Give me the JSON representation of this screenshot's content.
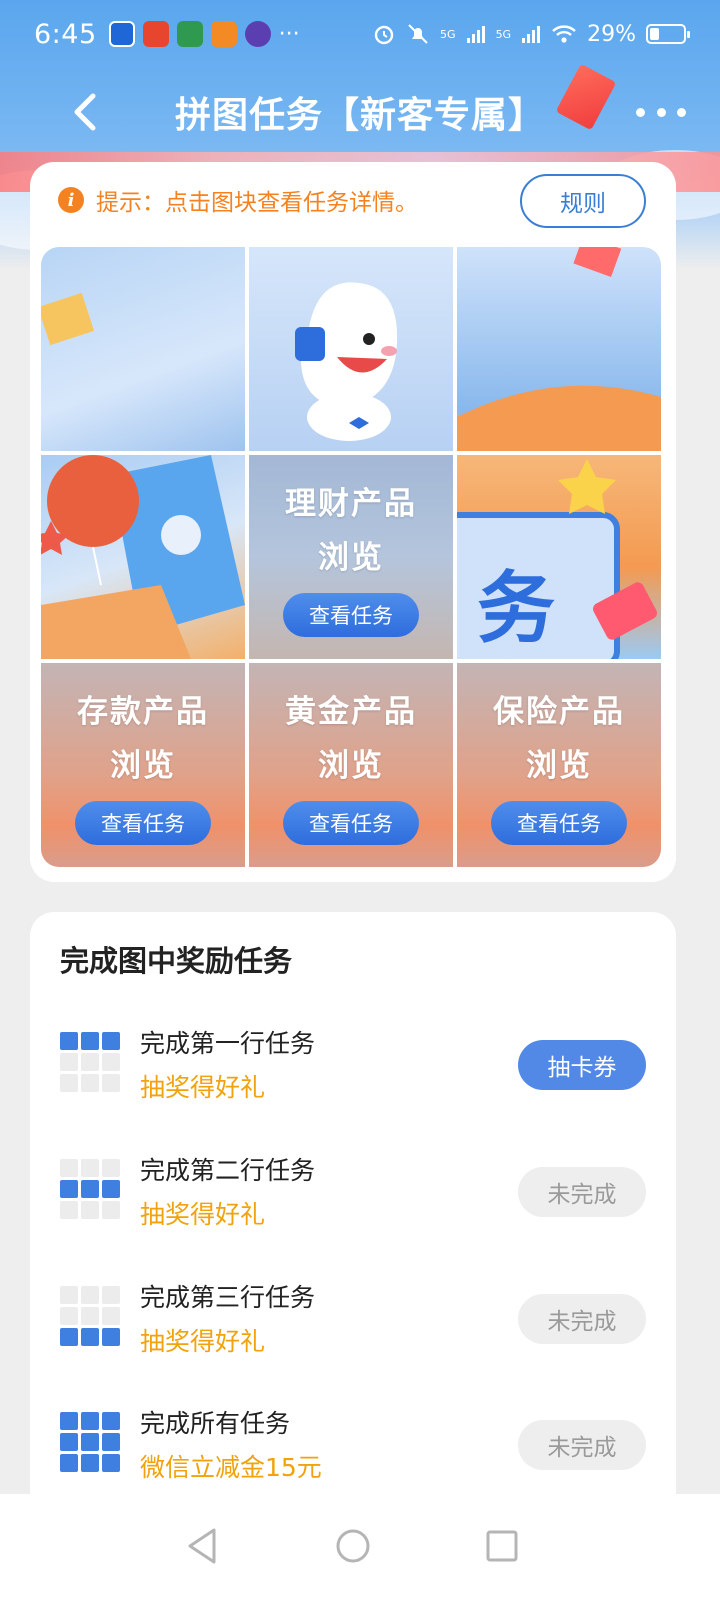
{
  "status_bar": {
    "time": "6:45",
    "network_a": "5G",
    "network_b": "5G",
    "battery": "29%",
    "battery_level": 0.29
  },
  "nav": {
    "title": "拼图任务【新客专属】"
  },
  "puzzle": {
    "tip": "提示：点击图块查看任务详情。",
    "rules_label": "规则",
    "tiles": [
      {
        "title_line1": "理财产品",
        "title_line2": "浏览",
        "button": "查看任务"
      },
      {
        "title_line1": "存款产品",
        "title_line2": "浏览",
        "button": "查看任务"
      },
      {
        "title_line1": "黄金产品",
        "title_line2": "浏览",
        "button": "查看任务"
      },
      {
        "title_line1": "保险产品",
        "title_line2": "浏览",
        "button": "查看任务"
      }
    ]
  },
  "rewards": {
    "title": "完成图中奖励任务",
    "tasks": [
      {
        "name": "完成第一行任务",
        "reward": "抽奖得好礼",
        "status": "抽卡券"
      },
      {
        "name": "完成第二行任务",
        "reward": "抽奖得好礼",
        "status": "未完成"
      },
      {
        "name": "完成第三行任务",
        "reward": "抽奖得好礼",
        "status": "未完成"
      },
      {
        "name": "完成所有任务",
        "reward": "微信立减金15元",
        "status": "未完成"
      }
    ]
  },
  "colors": {
    "accent": "#3e7fe0",
    "tip": "#f58220",
    "reward": "#f2a20c"
  }
}
